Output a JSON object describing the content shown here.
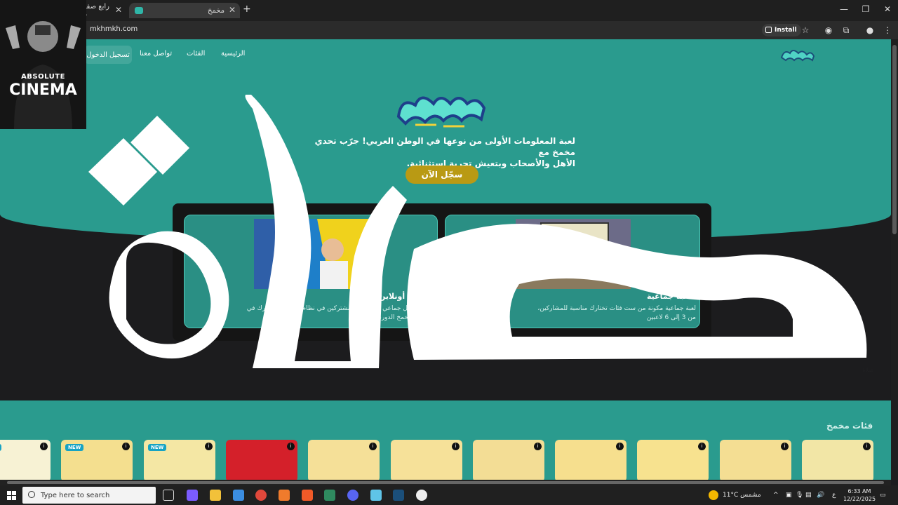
{
  "browser": {
    "tabs": [
      {
        "label": "رابع صفر م"
      },
      {
        "label": "مخمخ"
      }
    ],
    "new_tab": "+",
    "url": "mkhmkh.com",
    "install_label": "Install"
  },
  "site": {
    "nav": {
      "home": "الرئيسية",
      "categories": "الفئات",
      "contact": "تواصل معنا",
      "login": "تسجيل الدخول"
    },
    "hero_line1": "لعبة المعلومات الأولى من نوعها في الوطن العربي! جرّب تحدي مخمخ مع",
    "hero_line2": "الأهل والأصحاب وبتعيش تجربة استثنائية.",
    "register_label": "سجّل الآن",
    "modes": {
      "group_title": "لعبة جماعية",
      "group_desc_1": "لعبة جماعية مكونة من ست فئات تختارك مناسبة للمشاركين،",
      "group_desc_2": "من 3 إلى 6 لاعبين",
      "online_title": "العب أونلاين",
      "online_desc_1": "العب بشكل جماعي ضد خصوم مشتركين في نظام Online، وشارك في",
      "online_desc_2": "بطولات مخمخ الدوري"
    },
    "categories_title": "فئات مخمخ",
    "category_cards": [
      {
        "tag": "",
        "color": "#f2e6a6"
      },
      {
        "tag": "",
        "color": "#f4de93"
      },
      {
        "tag": "",
        "color": "#f7e28f"
      },
      {
        "tag": "",
        "color": "#f6df8e"
      },
      {
        "tag": "",
        "color": "#f3dd95"
      },
      {
        "tag": "",
        "color": "#f6e199"
      },
      {
        "tag": "",
        "color": "#f5e098"
      },
      {
        "tag": "",
        "color": "#d4202a"
      },
      {
        "tag": "NEW",
        "color": "#f4e7a4"
      },
      {
        "tag": "NEW",
        "color": "#f4df8f"
      },
      {
        "tag": "NEW",
        "color": "#f7f2d4"
      }
    ]
  },
  "overlay_text": "صلاة",
  "webcam": {
    "line1": "ABSOLUTE",
    "line2": "CINEMA"
  },
  "taskbar": {
    "search_placeholder": "Type here to search",
    "weather": "11°C  مشمس",
    "lang": "ع",
    "time": "6:33 AM",
    "date": "12/22/2025"
  },
  "colors": {
    "teal": "#2a9b8e",
    "card_border": "#4cc7b6",
    "register": "#b99a14"
  }
}
